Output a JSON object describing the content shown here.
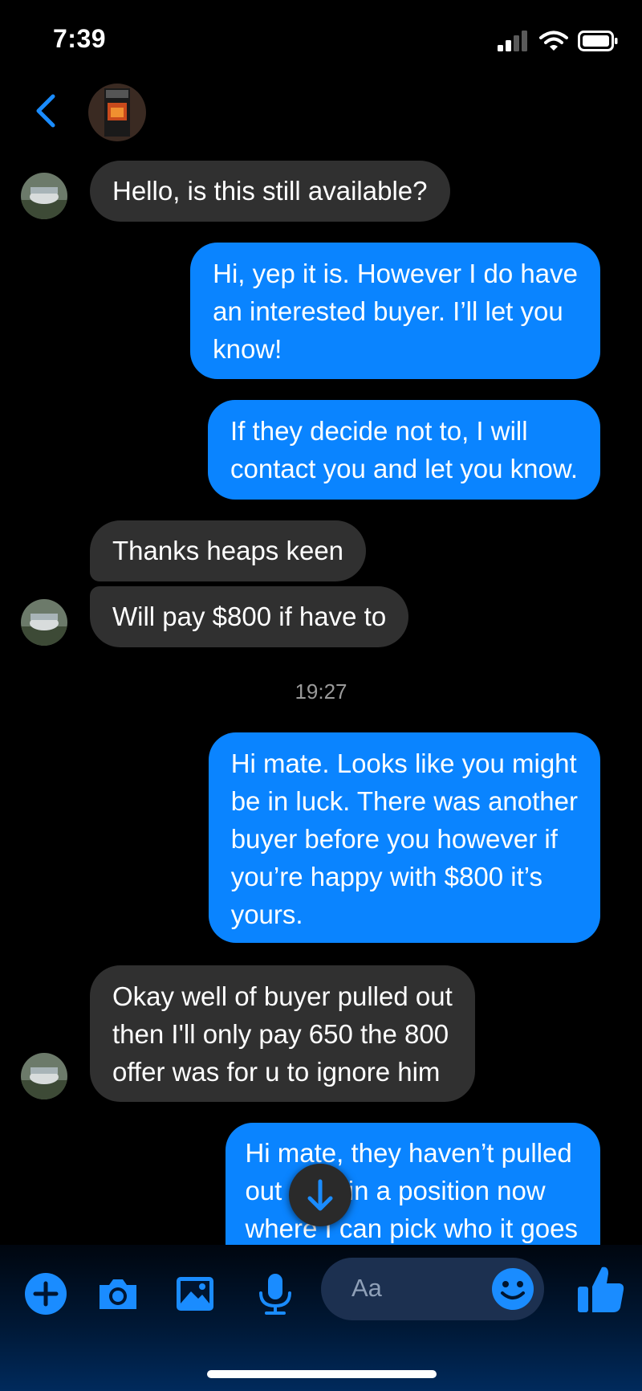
{
  "status_bar": {
    "time": "7:39"
  },
  "conversation": {
    "messages": [
      {
        "from": "them",
        "lines": [
          "Hello, is this still available?"
        ]
      },
      {
        "from": "me",
        "lines": [
          "Hi, yep it is. However I do have",
          "an interested buyer. I’ll let you",
          "know!"
        ]
      },
      {
        "from": "me",
        "lines": [
          "If they decide not to, I will",
          "contact you and let you know."
        ]
      },
      {
        "from": "them",
        "lines": [
          "Thanks heaps keen"
        ]
      },
      {
        "from": "them",
        "lines": [
          "Will pay $800 if have to"
        ]
      },
      {
        "from": "me",
        "lines": [
          "Hi mate. Looks like you might",
          "be in luck. There was another",
          "buyer before you however if",
          "you’re happy with $800 it’s",
          "yours."
        ]
      },
      {
        "from": "them",
        "lines": [
          "Okay well of buyer pulled out",
          "then I'll only pay 650 the 800",
          "offer was for u to ignore him"
        ]
      },
      {
        "from": "me",
        "lines": [
          "Hi mate, they haven’t pulled",
          "out - I’m in a position now",
          "where I can pick who it goes"
        ]
      }
    ],
    "timestamp": "19:27"
  },
  "composer": {
    "placeholder": "Aa",
    "icons": [
      "plus-icon",
      "camera-icon",
      "gallery-icon",
      "microphone-icon",
      "emoji-icon",
      "thumbs-up-icon"
    ]
  },
  "colors": {
    "sent_bubble": "#0a84ff",
    "received_bubble": "#303030",
    "accent": "#1a8cff",
    "background": "#000000"
  }
}
